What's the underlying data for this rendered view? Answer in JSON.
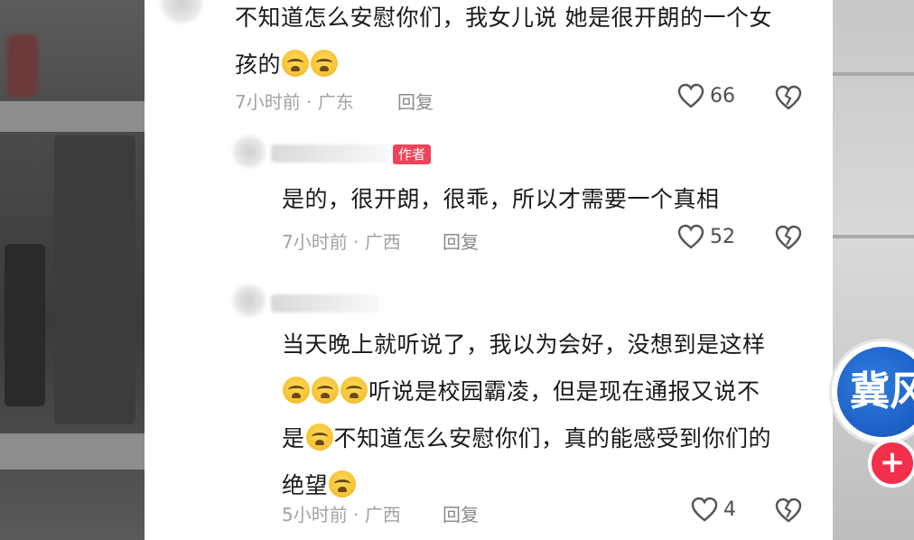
{
  "comments": [
    {
      "line1": "不知道怎么安慰你们，我女儿说 她是很开朗的一个女",
      "line2_text": "孩的",
      "time": "7小时前",
      "location": "广东",
      "reply": "回复",
      "likes": "66"
    },
    {
      "author_badge": "作者",
      "text": "是的，很开朗，很乖，所以才需要一个真相",
      "time": "7小时前",
      "location": "广西",
      "reply": "回复",
      "likes": "52"
    },
    {
      "line1": "当天晚上就听说了，我以为会好，没想到是这样",
      "line2_text": "听说是校园霸凌，但是现在通报又说不",
      "line3_pre": "是",
      "line3_post": "不知道怎么安慰你们，真的能感受到你们的",
      "line4": "绝望",
      "time": "5小时前",
      "location": "广西",
      "reply": "回复",
      "likes": "4"
    }
  ],
  "meta_separator": "·",
  "icons": {
    "like": "heart-outline-icon",
    "dislike": "broken-heart-icon",
    "emoji": "crying-face-emoji"
  },
  "logo_text": "冀风",
  "follow_symbol": "+",
  "colors": {
    "author_badge": "#f0435a",
    "follow_button": "#f3304b",
    "logo_blue": "#1451b8"
  }
}
